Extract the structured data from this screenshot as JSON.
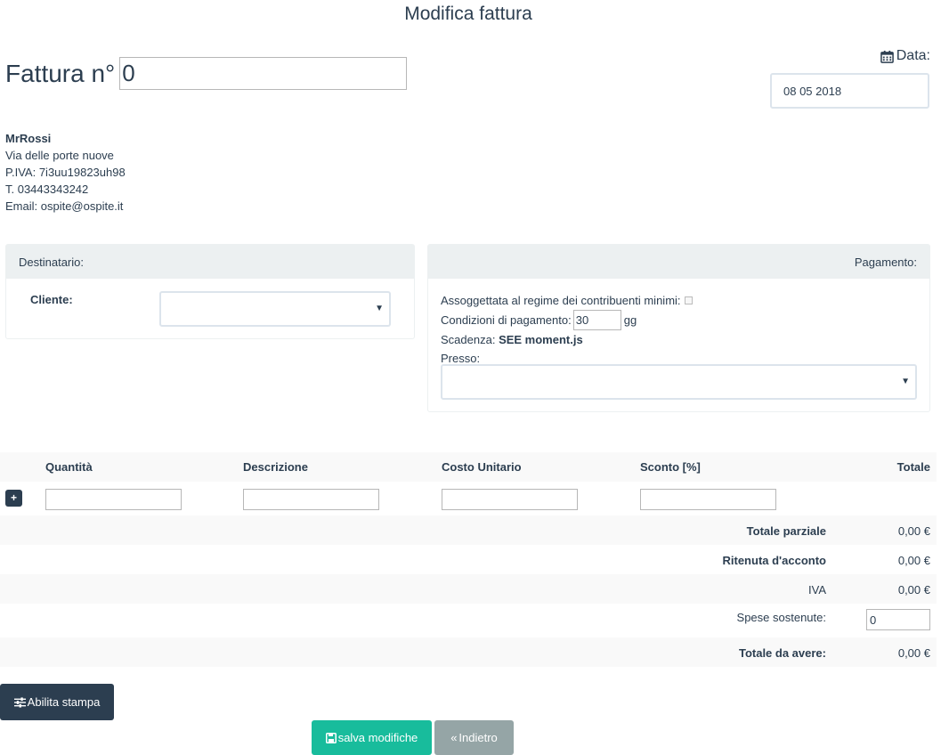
{
  "page": {
    "title": "Modifica fattura"
  },
  "invoice": {
    "label": "Fattura n°",
    "number": "0"
  },
  "date": {
    "label": "Data:",
    "value": "08 05 2018"
  },
  "sender": {
    "name": "MrRossi",
    "address": "Via delle porte nuove",
    "vat": "P.IVA: 7i3uu19823uh98",
    "phone": "T. 03443343242",
    "email": "Email: ospite@ospite.it"
  },
  "recipient_panel": {
    "heading": "Destinatario:",
    "client_label": "Cliente:",
    "client_value": ""
  },
  "payment_panel": {
    "heading": "Pagamento:",
    "minimi_label": "Assoggettata al regime dei contribuenti minimi:",
    "conditions_label": "Condizioni di pagamento:",
    "conditions_value": "30",
    "conditions_unit": "gg",
    "due_label": "Scadenza:",
    "due_value": "SEE moment.js",
    "presso_label": "Presso:",
    "presso_value": ""
  },
  "items_table": {
    "columns": [
      "Quantità",
      "Descrizione",
      "Costo Unitario",
      "Sconto [%]",
      "Totale"
    ],
    "add_label": "+"
  },
  "totals": {
    "partial_label": "Totale parziale",
    "partial_value": "0,00 €",
    "withholding_label": "Ritenuta d'acconto",
    "withholding_value": "0,00 €",
    "vat_label": "IVA",
    "vat_value": "0,00 €",
    "expenses_label": "Spese sostenute:",
    "expenses_value": "0",
    "due_label": "Totale da avere:",
    "due_value": "0,00 €"
  },
  "buttons": {
    "print": "Abilita stampa",
    "save": "salva modifiche",
    "back": "Indietro"
  },
  "icons": {
    "date": "calendar-icon",
    "print": "sliders-icon",
    "save": "floppy-disk-icon",
    "back": "double-chevron-left-icon"
  },
  "colors": {
    "primary": "#2c3e50",
    "success": "#18bc9c",
    "secondary": "#95a5a6",
    "panel_heading": "#ecf0f1"
  }
}
